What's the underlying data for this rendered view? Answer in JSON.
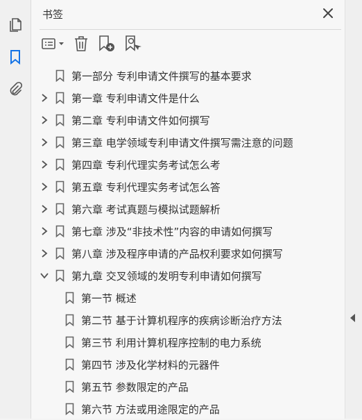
{
  "panel": {
    "title": "书签"
  },
  "icons": {
    "pages": "pages-icon",
    "bookmarks": "bookmark-icon",
    "attachments": "paperclip-icon",
    "close": "close-icon",
    "options": "options-menu-icon",
    "delete": "trash-icon",
    "new_bookmark": "new-bookmark-icon",
    "bookmark_from_selection": "bookmark-search-icon"
  },
  "colors": {
    "accent": "#1473e6",
    "text": "#333333",
    "icon": "#555555"
  },
  "bookmarks": [
    {
      "label": "第一部分  专利申请文件撰写的基本要求",
      "level": 0,
      "expand": "none"
    },
    {
      "label": "第一章  专利申请文件是什么",
      "level": 0,
      "expand": "collapsed"
    },
    {
      "label": "第二章  专利申请文件如何撰写",
      "level": 0,
      "expand": "collapsed"
    },
    {
      "label": "第三章  电学领域专利申请文件撰写需注意的问题",
      "level": 0,
      "expand": "collapsed"
    },
    {
      "label": "第四章  专利代理实务考试怎么考",
      "level": 0,
      "expand": "collapsed"
    },
    {
      "label": "第五章  专利代理实务考试怎么答",
      "level": 0,
      "expand": "collapsed"
    },
    {
      "label": "第六章  考试真题与模拟试题解析",
      "level": 0,
      "expand": "collapsed"
    },
    {
      "label": "第七章  涉及“非技术性”内容的申请如何撰写",
      "level": 0,
      "expand": "collapsed"
    },
    {
      "label": "第八章  涉及程序申请的产品权利要求如何撰写",
      "level": 0,
      "expand": "collapsed"
    },
    {
      "label": "第九章  交叉领域的发明专利申请如何撰写",
      "level": 0,
      "expand": "expanded"
    },
    {
      "label": "第一节  概述",
      "level": 1,
      "expand": "none"
    },
    {
      "label": "第二节  基于计算机程序的疾病诊断治疗方法",
      "level": 1,
      "expand": "none"
    },
    {
      "label": "第三节  利用计算机程序控制的电力系统",
      "level": 1,
      "expand": "none"
    },
    {
      "label": "第四节  涉及化学材料的元器件",
      "level": 1,
      "expand": "none"
    },
    {
      "label": "第五节  参数限定的产品",
      "level": 1,
      "expand": "none"
    },
    {
      "label": "第六节  方法或用途限定的产品",
      "level": 1,
      "expand": "none"
    }
  ]
}
